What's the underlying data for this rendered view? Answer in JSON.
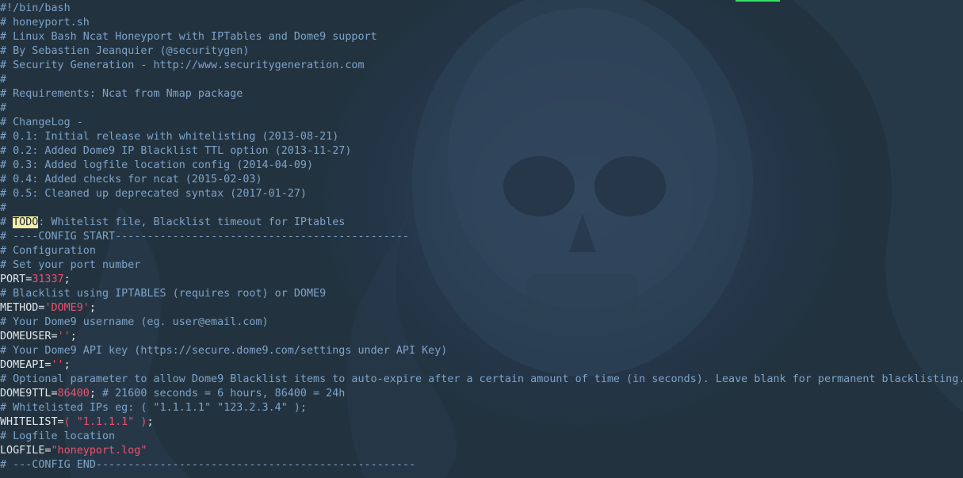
{
  "window": {
    "accent_cursor_color": "#37e06a",
    "background_color": "#243447"
  },
  "code_lines": [
    "#!/bin/bash",
    "# honeyport.sh",
    "# Linux Bash Ncat Honeyport with IPTables and Dome9 support",
    "# By Sebastien Jeanquier (@securitygen)",
    "# Security Generation - http://www.securitygeneration.com",
    "#",
    "# Requirements: Ncat from Nmap package",
    "#",
    "# ChangeLog -",
    "# 0.1: Initial release with whitelisting (2013-08-21)",
    "# 0.2: Added Dome9 IP Blacklist TTL option (2013-11-27)",
    "# 0.3: Added logfile location config (2014-04-09)",
    "# 0.4: Added checks for ncat (2015-02-03)",
    "# 0.5: Cleaned up deprecated syntax (2017-01-27)",
    "#",
    {
      "prefix": "# ",
      "todo": "TODO",
      "rest": ": Whitelist file, Blacklist timeout for IPtables"
    },
    "# ----CONFIG START----------------------------------------------",
    "# Configuration",
    "# Set your port number",
    {
      "var": "PORT=",
      "value": "31337",
      "end": ";"
    },
    "# Blacklist using IPTABLES (requires root) or DOME9",
    {
      "var": "METHOD=",
      "value": "'DOME9'",
      "end": ";"
    },
    "# Your Dome9 username (eg. user@email.com)",
    {
      "var": "DOMEUSER=",
      "value": "''",
      "end": ";"
    },
    "# Your Dome9 API key (https://secure.dome9.com/settings under API Key)",
    {
      "var": "DOMEAPI=",
      "value": "''",
      "end": ";"
    },
    "# Optional parameter to allow Dome9 Blacklist items to auto-expire after a certain amount of time (in seconds). Leave blank for permanent blacklisting.",
    {
      "var": "DOME9TTL=",
      "value": "86400",
      "end": "; ",
      "comment": "# 21600 seconds = 6 hours, 86400 = 24h"
    },
    "# Whitelisted IPs eg: ( \"1.1.1.1\" \"123.2.3.4\" );",
    {
      "var": "WHITELIST=",
      "value": "( \"1.1.1.1\" )",
      "end": ";"
    },
    "# Logfile location",
    {
      "var": "LOGFILE=",
      "value": "\"honeyport.log\"",
      "end": ""
    },
    "# ---CONFIG END--------------------------------------------------"
  ]
}
